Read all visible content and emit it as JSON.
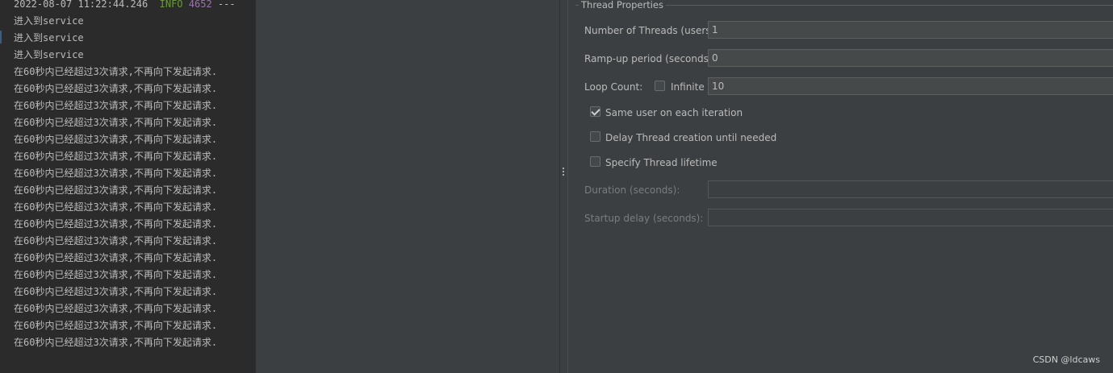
{
  "console": {
    "lines": [
      {
        "kind": "log",
        "timestamp": "2022-08-07 11:22:44.246",
        "level": "INFO",
        "pid": "4652",
        "sep": "---"
      },
      {
        "kind": "text",
        "text": "进入到service"
      },
      {
        "kind": "text",
        "text": "进入到service"
      },
      {
        "kind": "text",
        "text": "进入到service"
      },
      {
        "kind": "text",
        "text": "在60秒内已经超过3次请求,不再向下发起请求."
      },
      {
        "kind": "text",
        "text": "在60秒内已经超过3次请求,不再向下发起请求."
      },
      {
        "kind": "text",
        "text": "在60秒内已经超过3次请求,不再向下发起请求."
      },
      {
        "kind": "text",
        "text": "在60秒内已经超过3次请求,不再向下发起请求."
      },
      {
        "kind": "text",
        "text": "在60秒内已经超过3次请求,不再向下发起请求."
      },
      {
        "kind": "text",
        "text": "在60秒内已经超过3次请求,不再向下发起请求."
      },
      {
        "kind": "text",
        "text": "在60秒内已经超过3次请求,不再向下发起请求."
      },
      {
        "kind": "text",
        "text": "在60秒内已经超过3次请求,不再向下发起请求."
      },
      {
        "kind": "text",
        "text": "在60秒内已经超过3次请求,不再向下发起请求."
      },
      {
        "kind": "text",
        "text": "在60秒内已经超过3次请求,不再向下发起请求."
      },
      {
        "kind": "text",
        "text": "在60秒内已经超过3次请求,不再向下发起请求."
      },
      {
        "kind": "text",
        "text": "在60秒内已经超过3次请求,不再向下发起请求."
      },
      {
        "kind": "text",
        "text": "在60秒内已经超过3次请求,不再向下发起请求."
      },
      {
        "kind": "text",
        "text": "在60秒内已经超过3次请求,不再向下发起请求."
      },
      {
        "kind": "text",
        "text": "在60秒内已经超过3次请求,不再向下发起请求."
      },
      {
        "kind": "text",
        "text": "在60秒内已经超过3次请求,不再向下发起请求."
      },
      {
        "kind": "text",
        "text": "在60秒内已经超过3次请求,不再向下发起请求."
      }
    ]
  },
  "thread_properties": {
    "group_title": "Thread Properties",
    "num_threads_label": "Number of Threads (users):",
    "num_threads_value": "1",
    "ramp_up_label": "Ramp-up period (seconds):",
    "ramp_up_value": "0",
    "loop_count_label": "Loop Count:",
    "infinite_label": "Infinite",
    "infinite_checked": false,
    "loop_count_value": "10",
    "same_user_label": "Same user on each iteration",
    "same_user_checked": true,
    "delay_creation_label": "Delay Thread creation until needed",
    "delay_creation_checked": false,
    "specify_lifetime_label": "Specify Thread lifetime",
    "specify_lifetime_checked": false,
    "duration_label": "Duration (seconds):",
    "duration_value": "",
    "startup_delay_label": "Startup delay (seconds):",
    "startup_delay_value": ""
  },
  "watermark": "CSDN @ldcaws",
  "colors": {
    "console_bg": "#2b2b2b",
    "panel_bg": "#3c3f41",
    "info_green": "#6a9a3a",
    "pid_purple": "#9876aa",
    "text": "#bbbbbb"
  }
}
